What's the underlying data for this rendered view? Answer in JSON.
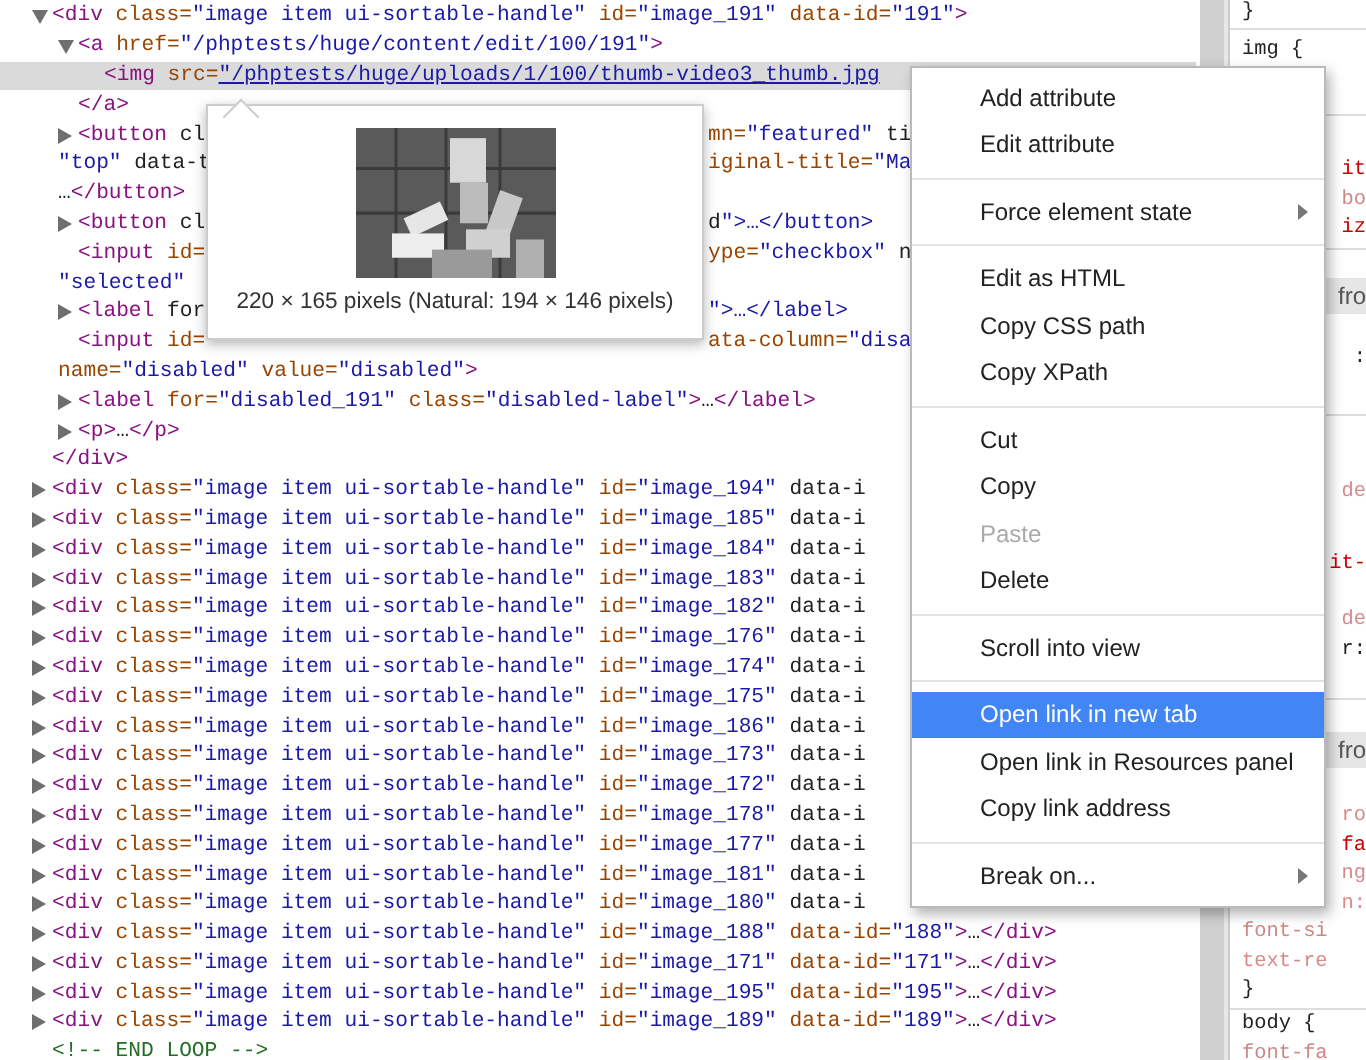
{
  "elements_panel": {
    "nodes": [
      {
        "expanded": true,
        "selected": false,
        "lines": [
          "<div class=\"image item ui-sortable-handle\" id=\"image_191\" data-id=\"191\">"
        ],
        "close": "</div>",
        "children": [
          {
            "expanded": true,
            "selected": false,
            "lines": [
              "<a href=\"/phptests/huge/content/edit/100/191\">"
            ],
            "close": "</a>",
            "children": [
              {
                "selected": true,
                "link": true,
                "lines": [
                  "<img src=\"/phptests/huge/uploads/1/100/thumb-video3_thumb.jpg"
                ]
              }
            ]
          },
          {
            "expanded": false,
            "selected": false,
            "lines": [
              {
                "left": "<button cl",
                "right": "mn=\"featured\" ti"
              },
              {
                "left": "\"top\" data-t",
                "right": "iginal-title=\"Ma"
              },
              "…</button>"
            ]
          },
          {
            "expanded": false,
            "selected": false,
            "lines": [
              {
                "left": "<button cl",
                "right": "d\">…</button>"
              }
            ]
          },
          {
            "selected": false,
            "lines": [
              {
                "left": "<input id=",
                "right": "ype=\"checkbox\" n"
              },
              "\"selected\""
            ]
          },
          {
            "expanded": false,
            "selected": false,
            "lines": [
              {
                "left": "<label for",
                "right": "\">…</label>"
              }
            ]
          },
          {
            "selected": false,
            "lines": [
              {
                "left": "<input id=",
                "right": "ata-column=\"disa"
              },
              "name=\"disabled\" value=\"disabled\">"
            ]
          },
          {
            "expanded": false,
            "selected": false,
            "lines": [
              "<label for=\"disabled_191\" class=\"disabled-label\">…</label>"
            ]
          },
          {
            "expanded": false,
            "selected": false,
            "lines": [
              "<p>…</p>"
            ]
          }
        ]
      },
      {
        "expanded": false,
        "selected": false,
        "lines": [
          "<div class=\"image item ui-sortable-handle\" id=\"image_194\" data-i"
        ]
      },
      {
        "expanded": false,
        "selected": false,
        "lines": [
          "<div class=\"image item ui-sortable-handle\" id=\"image_185\" data-i"
        ]
      },
      {
        "expanded": false,
        "selected": false,
        "lines": [
          "<div class=\"image item ui-sortable-handle\" id=\"image_184\" data-i"
        ]
      },
      {
        "expanded": false,
        "selected": false,
        "lines": [
          "<div class=\"image item ui-sortable-handle\" id=\"image_183\" data-i"
        ]
      },
      {
        "expanded": false,
        "selected": false,
        "lines": [
          "<div class=\"image item ui-sortable-handle\" id=\"image_182\" data-i"
        ]
      },
      {
        "expanded": false,
        "selected": false,
        "lines": [
          "<div class=\"image item ui-sortable-handle\" id=\"image_176\" data-i"
        ]
      },
      {
        "expanded": false,
        "selected": false,
        "lines": [
          "<div class=\"image item ui-sortable-handle\" id=\"image_174\" data-i"
        ]
      },
      {
        "expanded": false,
        "selected": false,
        "lines": [
          "<div class=\"image item ui-sortable-handle\" id=\"image_175\" data-i"
        ]
      },
      {
        "expanded": false,
        "selected": false,
        "lines": [
          "<div class=\"image item ui-sortable-handle\" id=\"image_186\" data-i"
        ]
      },
      {
        "expanded": false,
        "selected": false,
        "lines": [
          "<div class=\"image item ui-sortable-handle\" id=\"image_173\" data-i"
        ]
      },
      {
        "expanded": false,
        "selected": false,
        "lines": [
          "<div class=\"image item ui-sortable-handle\" id=\"image_172\" data-i"
        ]
      },
      {
        "expanded": false,
        "selected": false,
        "lines": [
          "<div class=\"image item ui-sortable-handle\" id=\"image_178\" data-i"
        ]
      },
      {
        "expanded": false,
        "selected": false,
        "lines": [
          "<div class=\"image item ui-sortable-handle\" id=\"image_177\" data-i"
        ]
      },
      {
        "expanded": false,
        "selected": false,
        "lines": [
          "<div class=\"image item ui-sortable-handle\" id=\"image_181\" data-i"
        ]
      },
      {
        "expanded": false,
        "selected": false,
        "lines": [
          "<div class=\"image item ui-sortable-handle\" id=\"image_180\" data-i"
        ]
      },
      {
        "expanded": false,
        "selected": false,
        "lines": [
          "<div class=\"image item ui-sortable-handle\" id=\"image_188\" data-id=\"188\">…</div>"
        ]
      },
      {
        "expanded": false,
        "selected": false,
        "lines": [
          "<div class=\"image item ui-sortable-handle\" id=\"image_171\" data-id=\"171\">…</div>"
        ]
      },
      {
        "expanded": false,
        "selected": false,
        "lines": [
          "<div class=\"image item ui-sortable-handle\" id=\"image_195\" data-id=\"195\">…</div>"
        ]
      },
      {
        "expanded": false,
        "selected": false,
        "lines": [
          "<div class=\"image item ui-sortable-handle\" id=\"image_189\" data-id=\"189\">…</div>"
        ]
      },
      {
        "selected": false,
        "lines": [
          "<!-- END LOOP -->"
        ]
      }
    ]
  },
  "image_tooltip": {
    "caption": "220 × 165 pixels (Natural: 194 × 146 pixels)",
    "kind": "picture"
  },
  "styles_panel": {
    "sections": [
      {
        "rows": [
          {
            "text": "}",
            "kind": "brace",
            "clipped": false
          }
        ]
      },
      {
        "rows": [
          {
            "text": "img {",
            "kind": "selector",
            "clipped": false
          }
        ]
      },
      {
        "rows": [
          {
            "text": "it",
            "kind": "property",
            "clipped": true
          },
          {
            "text": "bo",
            "kind": "struck",
            "clipped": true
          },
          {
            "text": "iz",
            "kind": "property",
            "clipped": true
          }
        ]
      },
      {
        "rows": [
          {
            "text": "fro",
            "kind": "source",
            "clipped": true
          },
          {
            "text": ":",
            "kind": "plain",
            "clipped": true
          }
        ]
      },
      {
        "rows": [
          {
            "text": "de",
            "kind": "inherited",
            "clipped": true
          },
          {
            "text": "it-",
            "kind": "property",
            "clipped": true
          },
          {
            "text": "de",
            "kind": "inherited",
            "clipped": true
          },
          {
            "text": "r:",
            "kind": "plain",
            "clipped": true
          }
        ]
      },
      {
        "rows": [
          {
            "text": "fro",
            "kind": "source",
            "clipped": true
          },
          {
            "text": "ro",
            "kind": "inherited",
            "clipped": true
          },
          {
            "text": "fa",
            "kind": "property",
            "clipped": true
          },
          {
            "text": "ng",
            "kind": "inherited",
            "clipped": true
          },
          {
            "text": "n:",
            "kind": "inherited",
            "clipped": true
          },
          {
            "text": "font-si",
            "kind": "struck",
            "clipped": false
          },
          {
            "text": "text-re",
            "kind": "inherited",
            "clipped": false
          },
          {
            "text": "}",
            "kind": "brace",
            "clipped": false
          }
        ]
      },
      {
        "rows": [
          {
            "text": "body {",
            "kind": "selector",
            "clipped": false
          },
          {
            "text": "font-fa",
            "kind": "struck",
            "clipped": false
          }
        ]
      }
    ]
  },
  "context_menu": {
    "items": [
      {
        "kind": "item",
        "label": "Add attribute",
        "selected": false,
        "disabled": false,
        "submenu": false
      },
      {
        "kind": "item",
        "label": "Edit attribute",
        "selected": false,
        "disabled": false,
        "submenu": false
      },
      {
        "kind": "separator"
      },
      {
        "kind": "item",
        "label": "Force element state",
        "selected": false,
        "disabled": false,
        "submenu": true
      },
      {
        "kind": "separator"
      },
      {
        "kind": "item",
        "label": "Edit as HTML",
        "selected": false,
        "disabled": false,
        "submenu": false
      },
      {
        "kind": "item",
        "label": "Copy CSS path",
        "selected": false,
        "disabled": false,
        "submenu": false
      },
      {
        "kind": "item",
        "label": "Copy XPath",
        "selected": false,
        "disabled": false,
        "submenu": false
      },
      {
        "kind": "separator"
      },
      {
        "kind": "item",
        "label": "Cut",
        "selected": false,
        "disabled": false,
        "submenu": false
      },
      {
        "kind": "item",
        "label": "Copy",
        "selected": false,
        "disabled": false,
        "submenu": false
      },
      {
        "kind": "item",
        "label": "Paste",
        "selected": false,
        "disabled": true,
        "submenu": false
      },
      {
        "kind": "item",
        "label": "Delete",
        "selected": false,
        "disabled": false,
        "submenu": false
      },
      {
        "kind": "separator"
      },
      {
        "kind": "item",
        "label": "Scroll into view",
        "selected": false,
        "disabled": false,
        "submenu": false
      },
      {
        "kind": "separator"
      },
      {
        "kind": "item",
        "label": "Open link in new tab",
        "selected": true,
        "disabled": false,
        "submenu": false
      },
      {
        "kind": "item",
        "label": "Open link in Resources panel",
        "selected": false,
        "disabled": false,
        "submenu": false
      },
      {
        "kind": "item",
        "label": "Copy link address",
        "selected": false,
        "disabled": false,
        "submenu": false
      },
      {
        "kind": "separator"
      },
      {
        "kind": "item",
        "label": "Break on...",
        "selected": false,
        "disabled": false,
        "submenu": true
      }
    ]
  }
}
